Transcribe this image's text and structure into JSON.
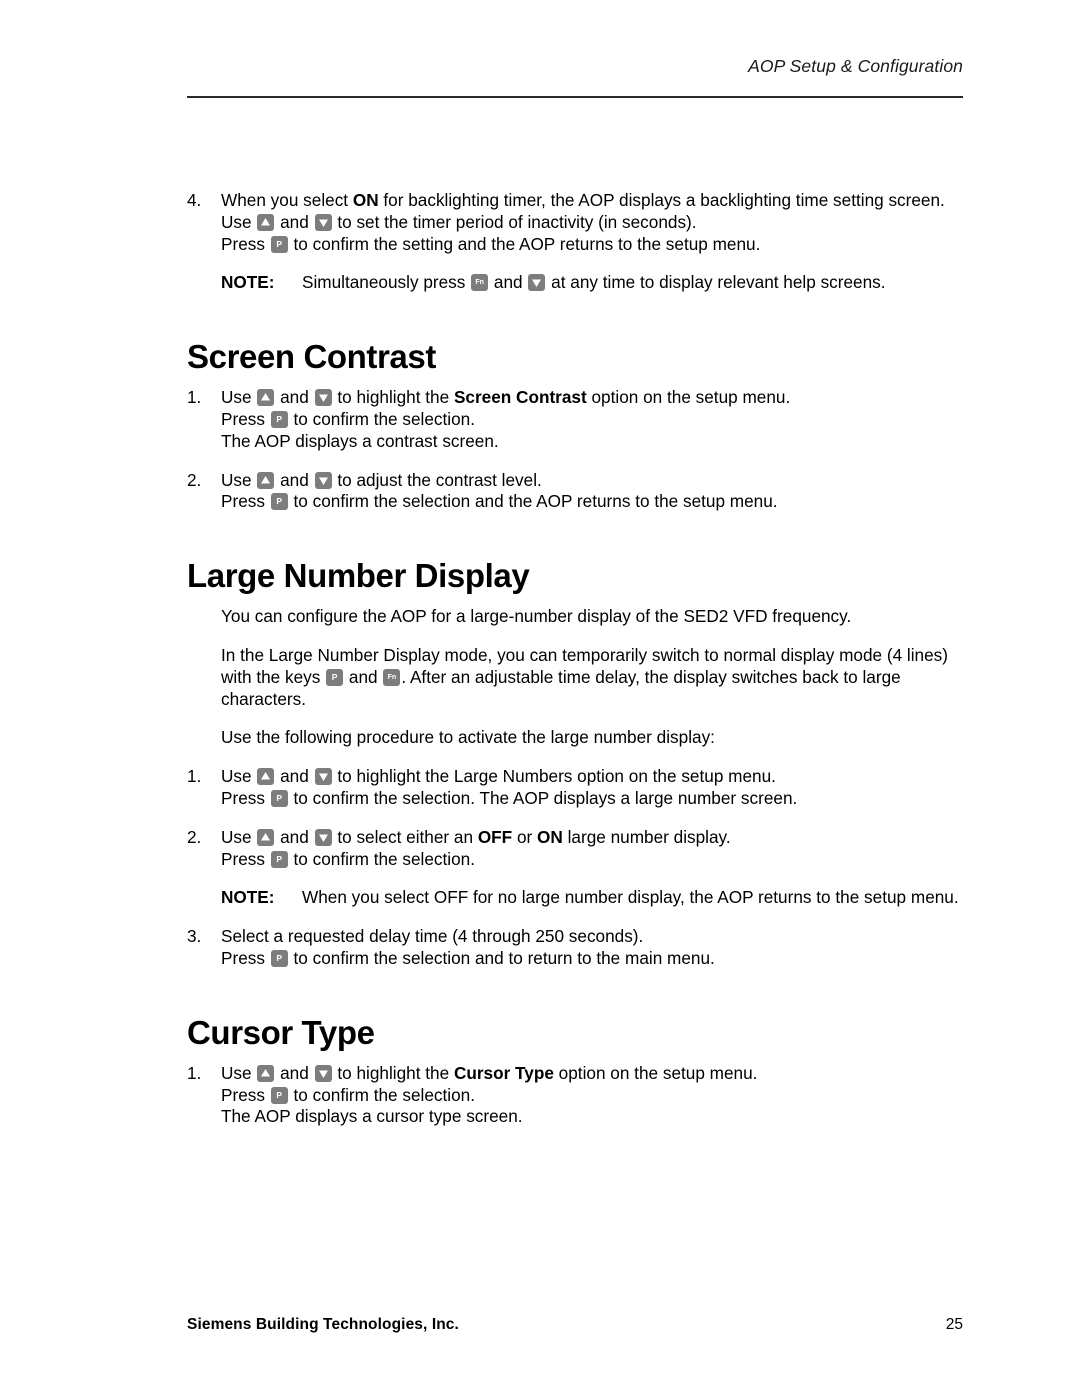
{
  "header": {
    "title": "AOP Setup & Configuration"
  },
  "body": {
    "item4": {
      "number": "4.",
      "line1_a": "When you select ",
      "line1_b": "ON",
      "line1_c": " for backlighting timer, the AOP displays a backlighting time setting screen.",
      "line2_a": "Use ",
      "line2_b": " and ",
      "line2_c": " to set the timer period of inactivity (in seconds).",
      "line3_a": "Press ",
      "line3_b": " to confirm the setting and the AOP returns to the setup menu."
    },
    "note1": {
      "label": "NOTE:",
      "text_a": "Simultaneously press ",
      "text_b": " and ",
      "text_c": " at any time to display relevant help screens."
    },
    "screen_contrast": {
      "heading": "Screen Contrast",
      "item1": {
        "number": "1.",
        "line1_a": "Use ",
        "line1_b": " and ",
        "line1_c": " to highlight the ",
        "line1_d": "Screen Contrast",
        "line1_e": " option on the setup menu.",
        "line2_a": "Press ",
        "line2_b": " to confirm the selection.",
        "line3": "The AOP displays a contrast screen."
      },
      "item2": {
        "number": "2.",
        "line1_a": "Use ",
        "line1_b": " and ",
        "line1_c": " to adjust the contrast level.",
        "line2_a": "Press ",
        "line2_b": " to confirm the selection and the AOP returns to the setup menu."
      }
    },
    "large_number_display": {
      "heading": "Large Number Display",
      "para1": "You can configure the AOP for a large-number display of the SED2 VFD frequency.",
      "para2_a": "In the Large Number Display mode, you can temporarily switch to normal display mode (4 lines) with the keys ",
      "para2_b": " and ",
      "para2_c": ". After an adjustable time delay, the display switches back to large characters.",
      "para3": "Use the following procedure to activate the large number display:",
      "item1": {
        "number": "1.",
        "line1_a": "Use ",
        "line1_b": " and ",
        "line1_c": " to highlight the Large Numbers option on the setup menu.",
        "line2_a": "Press ",
        "line2_b": " to confirm the selection. The AOP displays a large number screen."
      },
      "item2": {
        "number": "2.",
        "line1_a": "Use ",
        "line1_b": " and ",
        "line1_c": " to select either an ",
        "line1_d": "OFF",
        "line1_e": " or ",
        "line1_f": "ON",
        "line1_g": " large number display.",
        "line2_a": "Press ",
        "line2_b": " to confirm the selection."
      },
      "note2": {
        "label": "NOTE:",
        "text": "When you select OFF for no large number display, the AOP returns to the setup menu."
      },
      "item3": {
        "number": "3.",
        "line1": "Select a requested delay time (4 through 250 seconds).",
        "line2_a": "Press ",
        "line2_b": " to confirm the selection and to return to the main menu."
      }
    },
    "cursor_type": {
      "heading": "Cursor Type",
      "item1": {
        "number": "1.",
        "line1_a": "Use ",
        "line1_b": " and ",
        "line1_c": " to highlight the ",
        "line1_d": "Cursor Type",
        "line1_e": " option on the setup menu.",
        "line2_a": "Press ",
        "line2_b": " to confirm the selection.",
        "line3": "The AOP displays a cursor type screen."
      }
    }
  },
  "keys": {
    "up_label": "up-key",
    "down_label": "down-key",
    "p_label": "P",
    "fn_label": "Fn"
  },
  "footer": {
    "company": "Siemens Building Technologies, Inc.",
    "page_number": "25"
  },
  "colors": {
    "key_background": "#7d7d7d",
    "key_glyph": "#ffffff",
    "rule": "#2b2b2b",
    "text": "#000000"
  }
}
